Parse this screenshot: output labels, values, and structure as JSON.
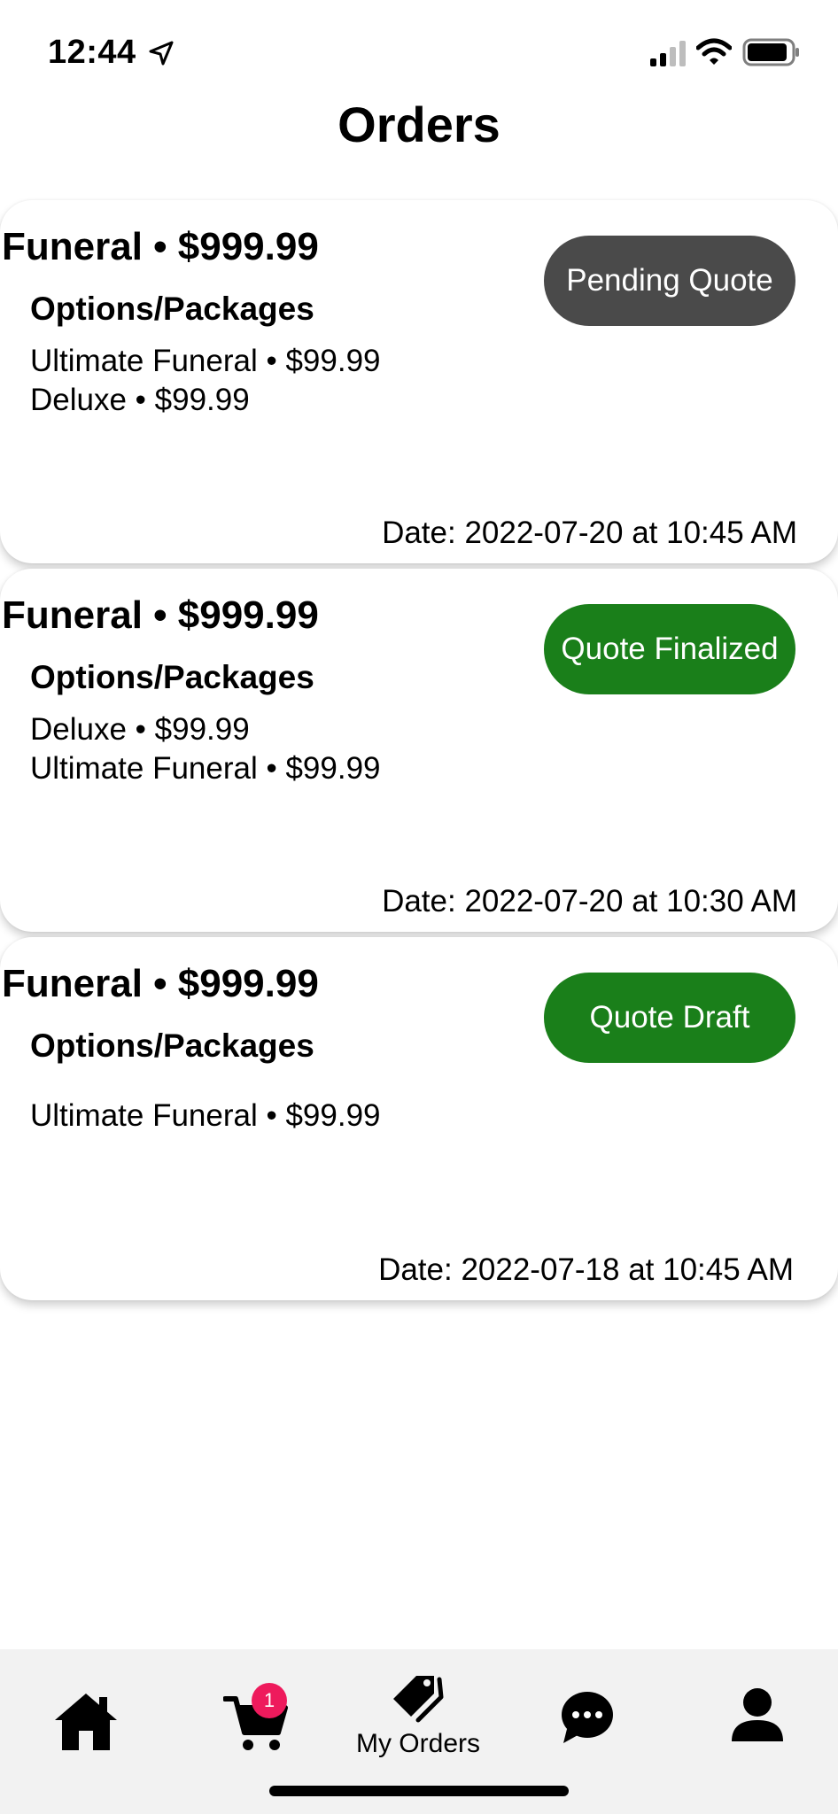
{
  "status_bar": {
    "time": "12:44",
    "icons": [
      "location-arrow-icon",
      "signal-icon",
      "wifi-icon",
      "battery-icon"
    ]
  },
  "page": {
    "title": "Orders"
  },
  "orders": [
    {
      "title": "Funeral • $999.99",
      "subtitle": "Options/Packages",
      "packages": [
        "Ultimate Funeral • $99.99",
        "Deluxe • $99.99"
      ],
      "status": "Pending Quote",
      "status_color": "#4a4a4a",
      "date": "Date: 2022-07-20 at 10:45 AM"
    },
    {
      "title": "Funeral • $999.99",
      "subtitle": "Options/Packages",
      "packages": [
        "Deluxe • $99.99",
        "Ultimate Funeral • $99.99"
      ],
      "status": "Quote Finalized",
      "status_color": "#1a7f1a",
      "date": "Date: 2022-07-20 at 10:30 AM"
    },
    {
      "title": "Funeral • $999.99",
      "subtitle": "Options/Packages",
      "packages": [
        "Ultimate Funeral • $99.99"
      ],
      "status": "Quote Draft",
      "status_color": "#1a7f1a",
      "date": "Date: 2022-07-18 at 10:45 AM"
    }
  ],
  "tab_bar": {
    "cart_badge": "1",
    "orders_label": "My Orders",
    "icons": [
      "home-icon",
      "cart-icon",
      "tag-icon",
      "chat-icon",
      "user-icon"
    ]
  },
  "colors": {
    "pending": "#4a4a4a",
    "finalized": "#1a7f1a",
    "badge": "#ee1a5c"
  }
}
